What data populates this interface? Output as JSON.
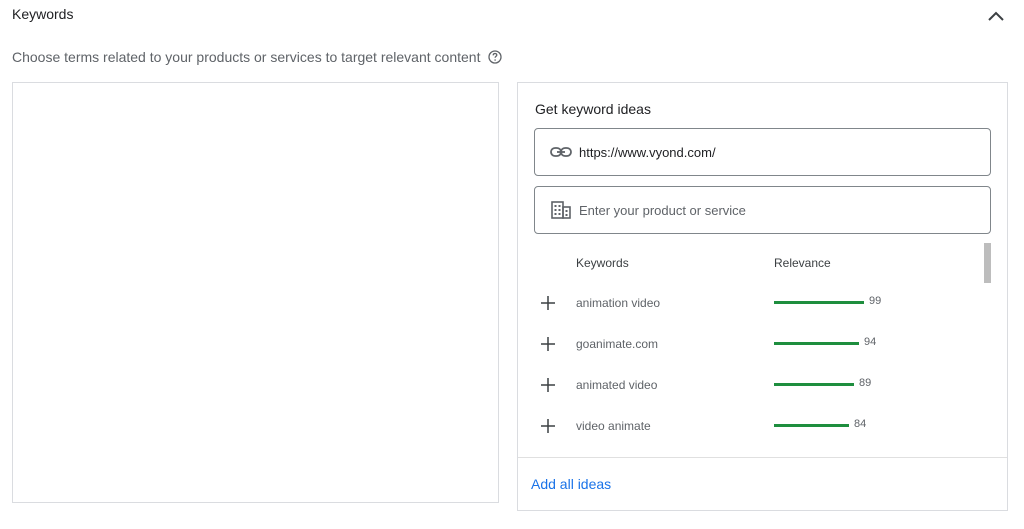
{
  "section": {
    "title": "Keywords",
    "description": "Choose terms related to your products or services to target relevant content"
  },
  "ideas": {
    "title": "Get keyword ideas",
    "url_value": "https://www.vyond.com/",
    "product_placeholder": "Enter your product or service",
    "columns": {
      "keywords": "Keywords",
      "relevance": "Relevance"
    },
    "rows": [
      {
        "keyword": "animation video",
        "relevance": "99"
      },
      {
        "keyword": "goanimate.com",
        "relevance": "94"
      },
      {
        "keyword": "animated video",
        "relevance": "89"
      },
      {
        "keyword": "video animate",
        "relevance": "84"
      }
    ],
    "add_all_label": "Add all ideas"
  },
  "colors": {
    "accent": "#1a73e8",
    "relevance_bar": "#1e8e3e"
  },
  "icons": [
    "chevron-up-icon",
    "help-icon",
    "link-icon",
    "building-icon",
    "plus-icon"
  ]
}
